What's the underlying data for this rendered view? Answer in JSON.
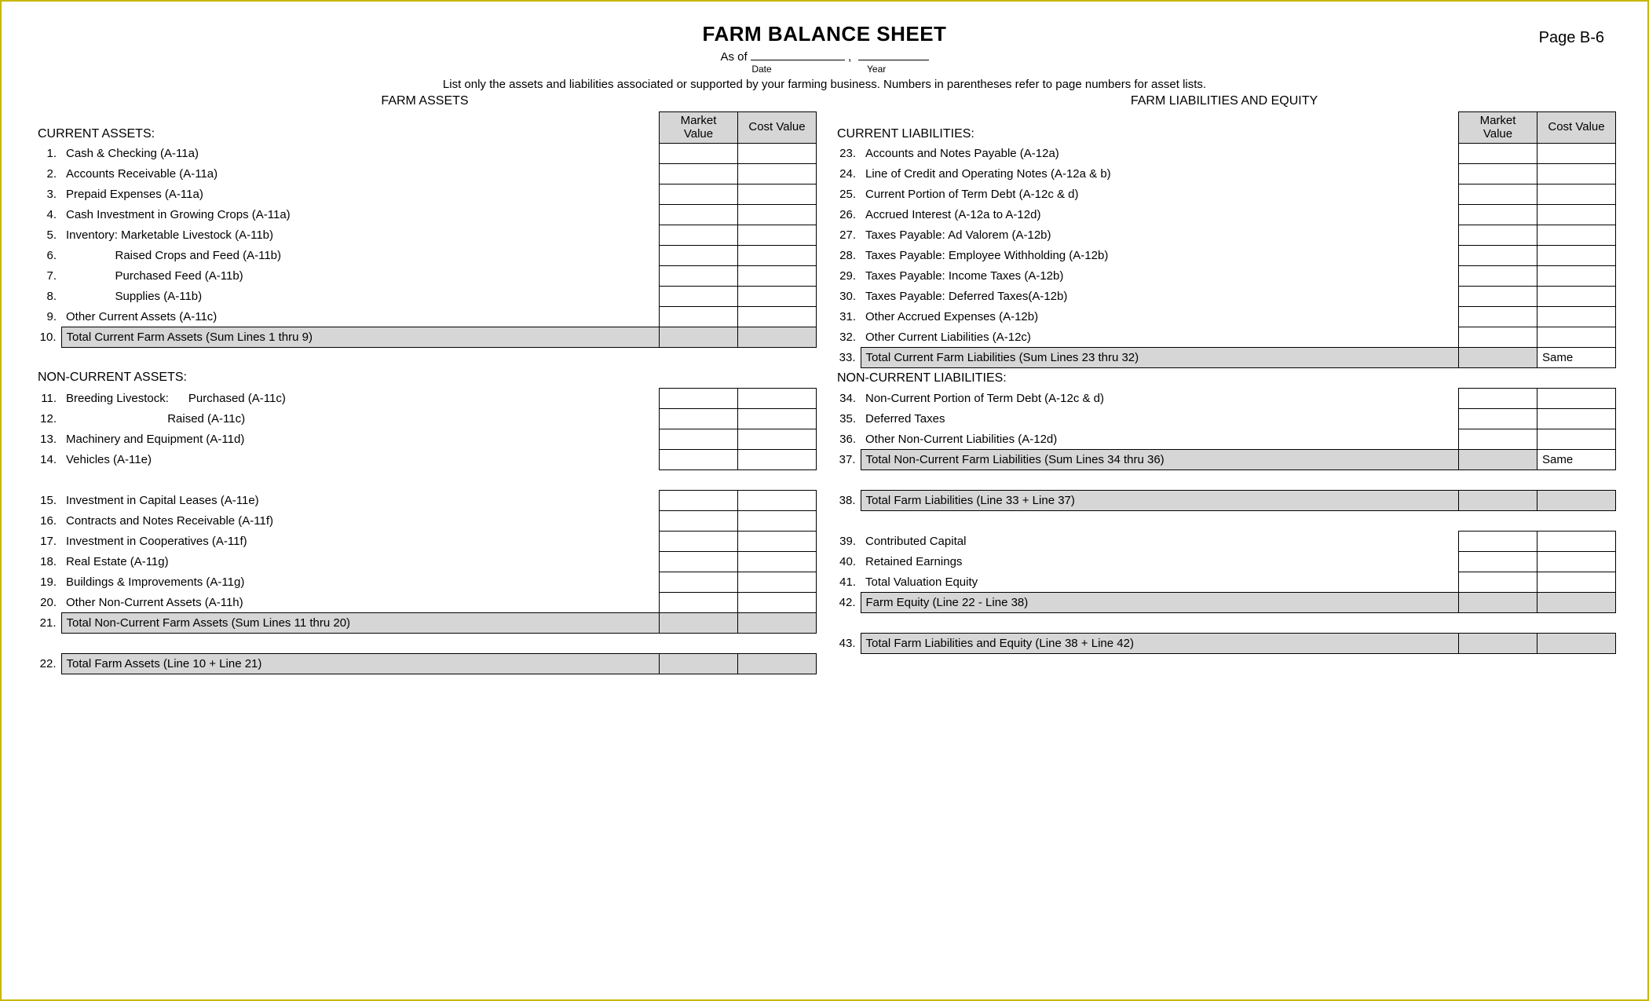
{
  "page_number": "Page B-6",
  "title": "FARM BALANCE SHEET",
  "asof_prefix": "As of",
  "date_sub": "Date",
  "year_sub": "Year",
  "instructions": "List only the assets and liabilities associated or supported by your farming business.  Numbers in parentheses refer to page numbers for asset lists.",
  "assets": {
    "col_title": "FARM ASSETS",
    "market_header": "Market Value",
    "cost_header": "Cost Value",
    "current_label": "CURRENT ASSETS:",
    "noncurrent_label": "NON-CURRENT ASSETS:",
    "current": [
      {
        "n": "1.",
        "label": "Cash & Checking (A-11a)"
      },
      {
        "n": "2.",
        "label": "Accounts Receivable (A-11a)"
      },
      {
        "n": "3.",
        "label": "Prepaid Expenses (A-11a)"
      },
      {
        "n": "4.",
        "label": "Cash Investment in Growing Crops (A-11a)"
      },
      {
        "n": "5.",
        "label": "Inventory:   Marketable Livestock (A-11b)"
      },
      {
        "n": "6.",
        "label": "               Raised Crops and Feed (A-11b)"
      },
      {
        "n": "7.",
        "label": "               Purchased Feed (A-11b)"
      },
      {
        "n": "8.",
        "label": "               Supplies (A-11b)"
      },
      {
        "n": "9.",
        "label": "Other Current Assets (A-11c)"
      }
    ],
    "total_current": {
      "n": "10.",
      "label": "Total Current Farm Assets (Sum Lines 1 thru 9)"
    },
    "noncurrent": [
      {
        "n": "11.",
        "label": "Breeding Livestock:      Purchased (A-11c)"
      },
      {
        "n": "12.",
        "label": "                               Raised (A-11c)"
      },
      {
        "n": "13.",
        "label": "Machinery and Equipment (A-11d)"
      },
      {
        "n": "14.",
        "label": "Vehicles (A-11e)"
      },
      {
        "n": "15.",
        "label": "Investment in Capital Leases (A-11e)"
      },
      {
        "n": "16.",
        "label": "Contracts and Notes Receivable (A-11f)"
      },
      {
        "n": "17.",
        "label": "Investment in Cooperatives (A-11f)"
      },
      {
        "n": "18.",
        "label": "Real Estate (A-11g)"
      },
      {
        "n": "19.",
        "label": "Buildings & Improvements (A-11g)"
      },
      {
        "n": "20.",
        "label": "Other Non-Current Assets (A-11h)"
      }
    ],
    "total_noncurrent": {
      "n": "21.",
      "label": "Total Non-Current Farm Assets (Sum Lines 11 thru 20)"
    },
    "total_farm": {
      "n": "22.",
      "label": "Total Farm Assets (Line 10 + Line 21)"
    }
  },
  "liab": {
    "col_title": "FARM LIABILITIES AND EQUITY",
    "market_header": "Market Value",
    "cost_header": "Cost Value",
    "current_label": "CURRENT LIABILITIES:",
    "noncurrent_label": "NON-CURRENT LIABILITIES:",
    "same_text": "Same",
    "current": [
      {
        "n": "23.",
        "label": "Accounts and Notes Payable (A-12a)"
      },
      {
        "n": "24.",
        "label": "Line of Credit and Operating Notes (A-12a & b)"
      },
      {
        "n": "25.",
        "label": "Current Portion of Term Debt (A-12c & d)"
      },
      {
        "n": "26.",
        "label": "Accrued Interest (A-12a to A-12d)"
      },
      {
        "n": "27.",
        "label": "Taxes Payable:  Ad Valorem (A-12b)"
      },
      {
        "n": "28.",
        "label": "Taxes Payable:  Employee Withholding (A-12b)"
      },
      {
        "n": "29.",
        "label": "Taxes Payable:  Income Taxes (A-12b)"
      },
      {
        "n": "30.",
        "label": "Taxes Payable:  Deferred Taxes(A-12b)"
      },
      {
        "n": "31.",
        "label": "Other Accrued Expenses (A-12b)"
      },
      {
        "n": "32.",
        "label": "Other Current Liabilities (A-12c)"
      }
    ],
    "total_current": {
      "n": "33.",
      "label": "Total Current Farm Liabilities (Sum Lines 23 thru 32)"
    },
    "noncurrent": [
      {
        "n": "34.",
        "label": "Non-Current Portion of Term Debt (A-12c & d)"
      },
      {
        "n": "35.",
        "label": "Deferred Taxes"
      },
      {
        "n": "36.",
        "label": "Other Non-Current Liabilities (A-12d)"
      }
    ],
    "total_noncurrent": {
      "n": "37.",
      "label": "Total Non-Current Farm Liabilities  (Sum Lines 34 thru 36)"
    },
    "total_farm_liab": {
      "n": "38.",
      "label": "Total Farm Liabilities  (Line 33 + Line 37)"
    },
    "equity": [
      {
        "n": "39.",
        "label": "Contributed Capital"
      },
      {
        "n": "40.",
        "label": "Retained Earnings"
      },
      {
        "n": "41.",
        "label": "Total Valuation Equity"
      }
    ],
    "farm_equity": {
      "n": "42.",
      "label": "Farm Equity (Line 22 - Line 38)"
    },
    "total_liab_equity": {
      "n": "43.",
      "label": "Total Farm Liabilities and Equity (Line 38 + Line 42)"
    }
  }
}
